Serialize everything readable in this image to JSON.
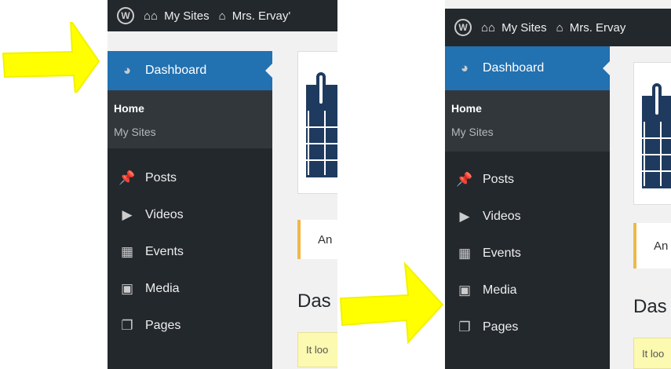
{
  "admin_bar": {
    "my_sites": "My Sites",
    "site_name_left": "Mrs. Ervay'",
    "site_name_right": "Mrs. Ervay"
  },
  "menu": {
    "dashboard": "Dashboard",
    "home": "Home",
    "my_sites": "My Sites",
    "posts": "Posts",
    "videos": "Videos",
    "events": "Events",
    "media": "Media",
    "pages": "Pages"
  },
  "content": {
    "notice_text": "An",
    "heading": "Das",
    "yellow_notice": "It loo"
  },
  "annotations": {
    "arrow_color": "#ffff00",
    "arrow_left_points_to": "Dashboard",
    "arrow_right_points_to": "Media"
  },
  "colors": {
    "sidebar": "#23282d",
    "active": "#2271b1",
    "submenu": "#32373c"
  }
}
